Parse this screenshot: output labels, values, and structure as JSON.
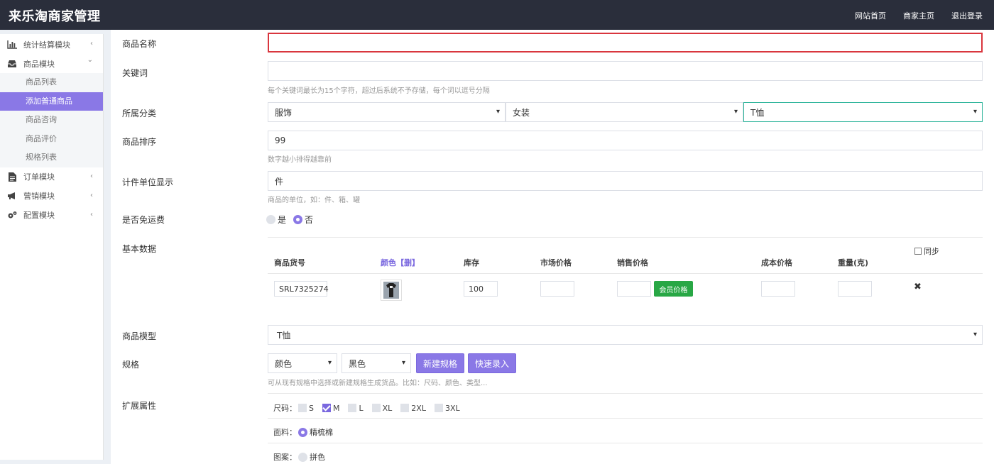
{
  "app": {
    "title": "来乐淘商家管理"
  },
  "topnav": [
    "网站首页",
    "商家主页",
    "退出登录"
  ],
  "sidebar": {
    "groups": [
      {
        "label": "统计结算模块",
        "icon": "bar-chart-icon",
        "chevron": "‹"
      },
      {
        "label": "商品模块",
        "icon": "inbox-icon",
        "chevron": "⌄"
      },
      {
        "label": "订单模块",
        "icon": "file-icon",
        "chevron": "‹"
      },
      {
        "label": "营销模块",
        "icon": "megaphone-icon",
        "chevron": "‹"
      },
      {
        "label": "配置模块",
        "icon": "cogs-icon",
        "chevron": "‹"
      }
    ],
    "sub_items": [
      "商品列表",
      "添加普通商品",
      "商品咨询",
      "商品评价",
      "规格列表"
    ],
    "active_sub": "添加普通商品"
  },
  "form": {
    "name": {
      "label": "商品名称",
      "value": ""
    },
    "keywords": {
      "label": "关键词",
      "value": "",
      "hint": "每个关键词最长为15个字符，超过后系统不予存储，每个词以逗号分隔"
    },
    "category": {
      "label": "所属分类",
      "level1": "服饰",
      "level2": "女装",
      "level3": "T恤"
    },
    "sort": {
      "label": "商品排序",
      "value": "99",
      "hint": "数字越小排得越靠前"
    },
    "unit": {
      "label": "计件单位显示",
      "value": "件",
      "hint": "商品的单位，如：件、箱、罐"
    },
    "free_shipping": {
      "label": "是否免运费",
      "yes": "是",
      "no": "否",
      "selected": "否"
    },
    "basic": {
      "label": "基本数据",
      "sync": "同步",
      "headers": [
        "商品货号",
        "颜色【删】",
        "库存",
        "市场价格",
        "销售价格",
        "成本价格",
        "重量(克)"
      ],
      "row": {
        "sku": "SRL7325274",
        "stock": "100",
        "market_price": "",
        "sale_price": "",
        "cost_price": "",
        "weight": ""
      },
      "member_price_button": "会员价格",
      "delete_icon": "✖"
    },
    "model": {
      "label": "商品模型",
      "value": "T恤"
    },
    "spec": {
      "label": "规格",
      "select1": "颜色",
      "select2": "黑色",
      "new_button": "新建规格",
      "quick_button": "快速录入",
      "hint": "可从现有规格中选择或新建规格生成货品。比如：尺码、颜色、类型..."
    },
    "ext": {
      "label": "扩展属性",
      "size_label": "尺码：",
      "sizes": [
        {
          "name": "S",
          "checked": false
        },
        {
          "name": "M",
          "checked": true
        },
        {
          "name": "L",
          "checked": false
        },
        {
          "name": "XL",
          "checked": false
        },
        {
          "name": "2XL",
          "checked": false
        },
        {
          "name": "3XL",
          "checked": false
        }
      ],
      "fabric_label": "面料：",
      "fabric_option": "精梳棉",
      "pattern_label": "图案：",
      "pattern_option": "拼色"
    }
  }
}
